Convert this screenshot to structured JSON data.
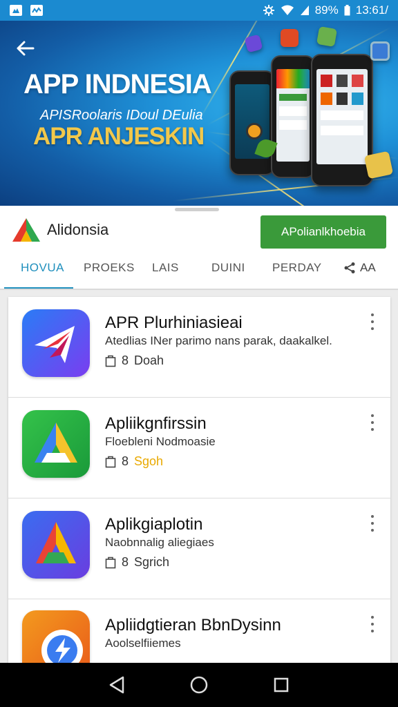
{
  "status_bar": {
    "battery": "89%",
    "time": "13:61/"
  },
  "banner": {
    "title": "APP INDNESIA",
    "subtitle": "APISRoolaris IDoul DEulia",
    "tagline": "APR ANJESKIN"
  },
  "developer": {
    "name": "Alidonsia",
    "install_label": "APolianlkhoebia"
  },
  "tabs": [
    {
      "label": "HOVUA",
      "active": true
    },
    {
      "label": "PROEKS",
      "active": false
    },
    {
      "label": "LAIS",
      "active": false
    },
    {
      "label": "DUINI",
      "active": false
    },
    {
      "label": "PERDAY",
      "active": false
    }
  ],
  "share_label": "AA",
  "apps": [
    {
      "title": "APR Plurhiniasieai",
      "description": "Atedlias INer parimo nans parak, daakalkel.",
      "size": "8",
      "meta": "Doah",
      "meta_highlight": false
    },
    {
      "title": "Apliikgnfirssin",
      "description": "Floebleni Nodmoasie",
      "size": "8",
      "meta": "Sgoh",
      "meta_highlight": true
    },
    {
      "title": "Aplikgiaplotin",
      "description": "Naobnnalig aliegiaes",
      "size": "8",
      "meta": "Sgrich",
      "meta_highlight": false
    },
    {
      "title": "Apliidgtieran BbnDysinn",
      "description": "Aoolselfiiemes",
      "size": "",
      "meta": "",
      "meta_highlight": false
    }
  ],
  "colors": {
    "accent": "#1f8fbd",
    "install": "#3a9a3a",
    "status_bar": "#1b8ad0",
    "highlight": "#e9a900"
  }
}
